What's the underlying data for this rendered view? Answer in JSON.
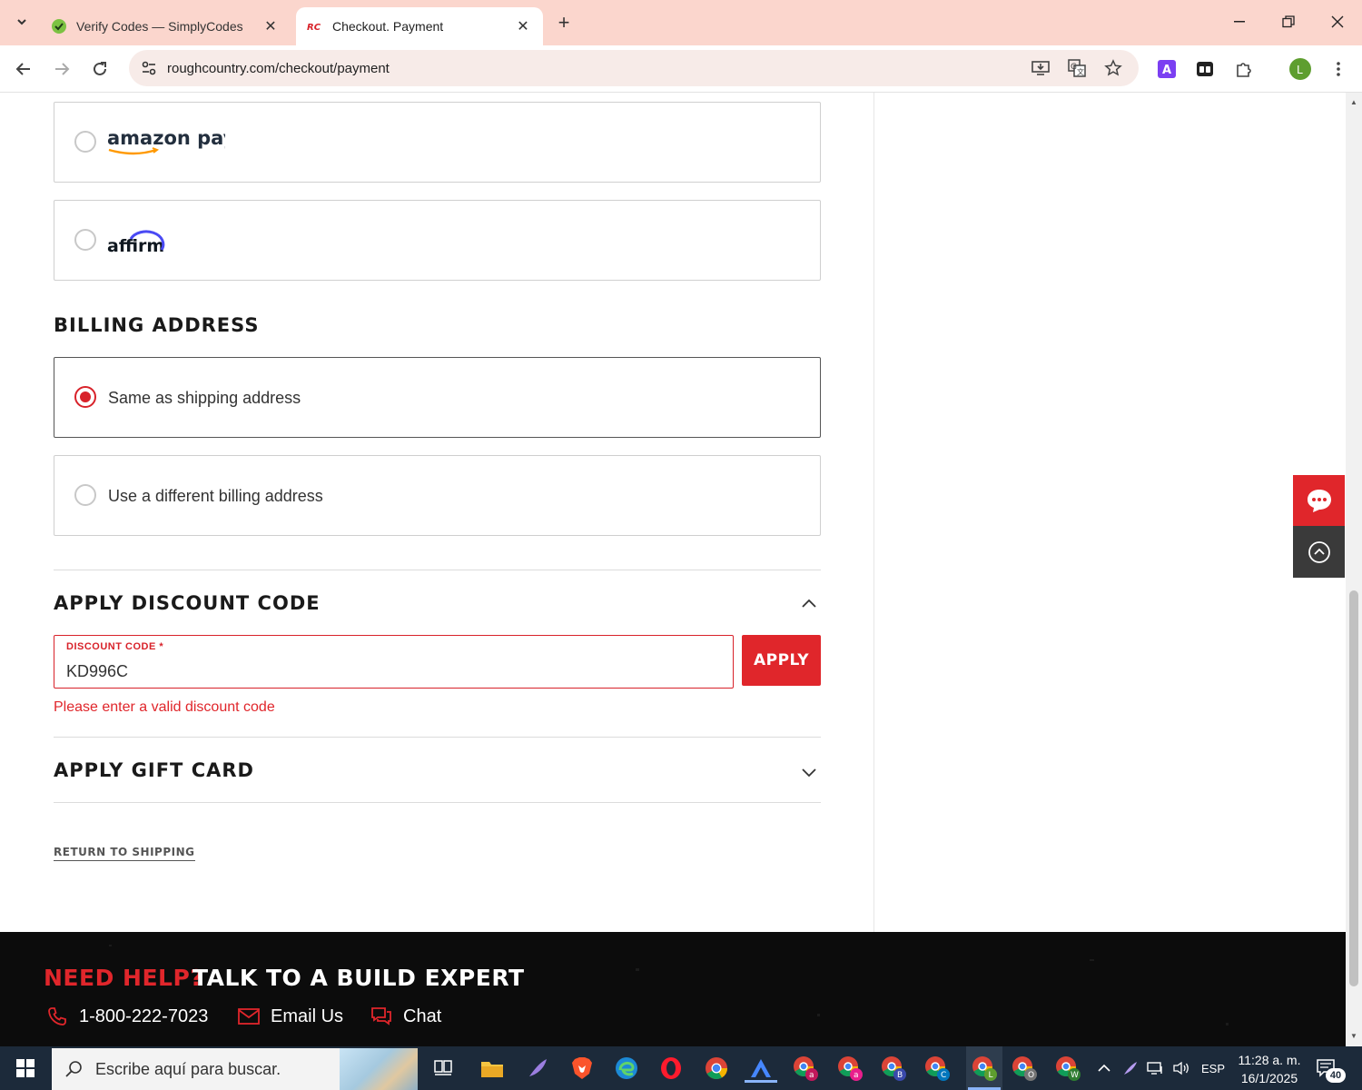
{
  "browser": {
    "tabs": [
      {
        "title": "Verify Codes — SimplyCodes",
        "active": false
      },
      {
        "title": "Checkout. Payment",
        "active": true
      }
    ],
    "url": "roughcountry.com/checkout/payment",
    "profile_initial": "L",
    "extension_letter": "A"
  },
  "payment": {
    "options": [
      {
        "name": "amazon pay",
        "selected": false
      },
      {
        "name": "affirm",
        "selected": false
      }
    ]
  },
  "billing": {
    "title": "BILLING ADDRESS",
    "options": [
      {
        "label": "Same as shipping address",
        "selected": true
      },
      {
        "label": "Use a different billing address",
        "selected": false
      }
    ]
  },
  "discount": {
    "title": "APPLY DISCOUNT CODE",
    "field_label": "DISCOUNT CODE *",
    "value": "KD996C",
    "apply_label": "APPLY",
    "error": "Please enter a valid discount code"
  },
  "gift_card": {
    "title": "APPLY GIFT CARD"
  },
  "return_link": "RETURN TO SHIPPING",
  "footer": {
    "need_help": "NEED HELP?",
    "build_expert": "TALK TO A BUILD EXPERT",
    "phone": "1-800-222-7023",
    "email": "Email Us",
    "chat": "Chat"
  },
  "taskbar": {
    "search_placeholder": "Escribe aquí para buscar.",
    "language": "ESP",
    "time": "11:28 a. m.",
    "date": "16/1/2025",
    "notifications": "40",
    "profile_badges": [
      "a",
      "a",
      "B",
      "C",
      "L",
      "O",
      "W"
    ]
  },
  "colors": {
    "accent_red": "#e0262b",
    "tabbar_bg": "#fbd6cd",
    "footer_bg": "#0c0c0c",
    "taskbar_bg": "#1c2a3a"
  }
}
